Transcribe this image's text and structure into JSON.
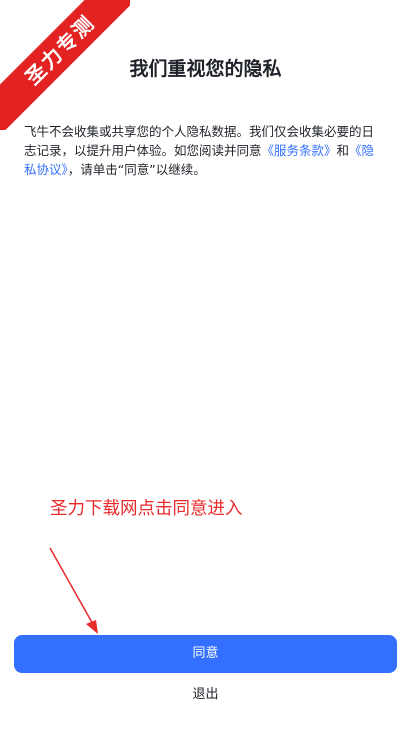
{
  "watermark": {
    "text": "圣力专测",
    "color": "#e32222"
  },
  "privacy": {
    "title": "我们重视您的隐私",
    "text_1": "飞牛不会收集或共享您的个人隐私数据。我们仅会收集必要的日志记录，以提升用户体验。如您阅读并同意",
    "link_service": "《服务条款》",
    "text_2": "和",
    "link_privacy": "《隐私协议》",
    "text_3": "，请单击“同意”以继续。"
  },
  "overlay": {
    "promo_text": "圣力下载网点击同意进入",
    "color": "#e82a2a"
  },
  "actions": {
    "agree_label": "同意",
    "exit_label": "退出"
  },
  "colors": {
    "accent": "#3370ff",
    "text": "#1f2329"
  }
}
